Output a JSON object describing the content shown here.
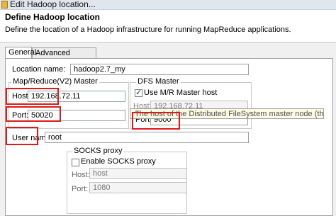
{
  "window": {
    "title": "Edit Hadoop location..."
  },
  "header": {
    "title": "Define Hadoop location",
    "description": "Define the location of a Hadoop infrastructure for running MapReduce applications."
  },
  "tabs": [
    {
      "label": "General",
      "active": true
    },
    {
      "label": "Advanced parameters",
      "active": false
    }
  ],
  "location": {
    "label": "Location name:",
    "value": "hadoop2.7_my"
  },
  "mr_master": {
    "title": "Map/Reduce(V2) Master",
    "host_label": "Host:",
    "host_value": "192.168.72.11",
    "port_label": "Port:",
    "port_value": "50020"
  },
  "dfs_master": {
    "title": "DFS Master",
    "use_mr_label": "Use M/R Master host",
    "use_mr_checked": true,
    "host_label": "Host:",
    "host_value": "192.168.72.11",
    "port_label": "Port:",
    "port_value": "9000"
  },
  "tooltip": {
    "text": "The host of the Distributed FileSystem master node (the Name Node)."
  },
  "user": {
    "label": "User name:",
    "value": "root"
  },
  "socks": {
    "title": "SOCKS proxy",
    "enable_label": "Enable SOCKS proxy",
    "enable_checked": false,
    "host_label": "Host:",
    "host_value": "host",
    "port_label": "Port:",
    "port_value": "1080"
  },
  "colors": {
    "highlight": "#e01818",
    "header_bg": "#ffffff",
    "dialog_bg": "#f0f0f0"
  }
}
